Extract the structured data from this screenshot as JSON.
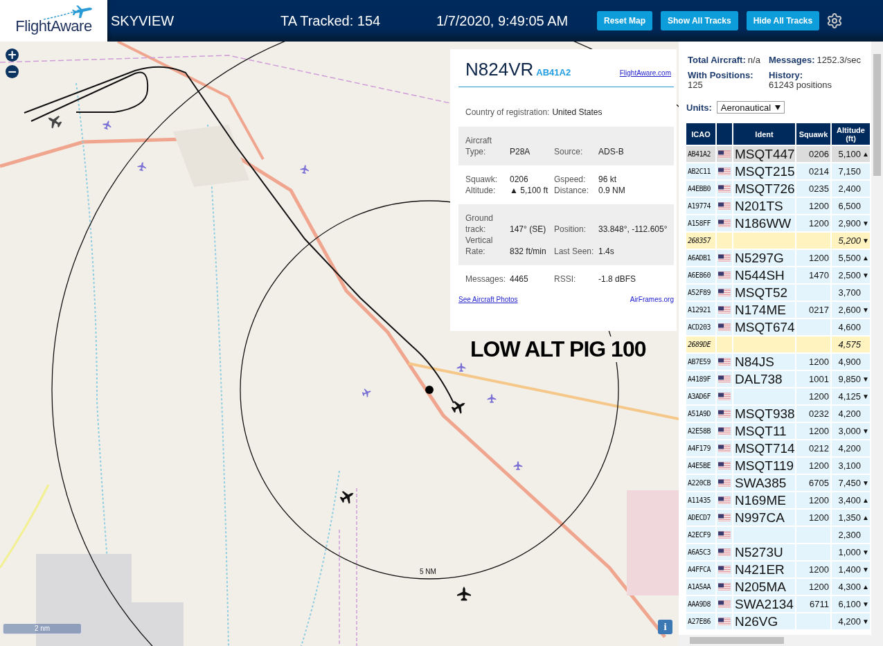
{
  "header": {
    "logo": "FlightAware",
    "title": "SKYVIEW",
    "tracked": "TA Tracked: 154",
    "datetime": "1/7/2020, 9:49:05 AM",
    "buttons": [
      "Reset Map",
      "Show All Tracks",
      "Hide All Tracks"
    ]
  },
  "map": {
    "zoom_in": "+",
    "zoom_out": "−",
    "range_label": "5 NM",
    "annotation": "LOW ALT PIG 100",
    "scale": "2 nm",
    "info_button": "i"
  },
  "popup": {
    "registration": "N824VR",
    "icao": "AB41A2",
    "link": "FlightAware.com",
    "country_label": "Country of registration:",
    "country": "United States",
    "sections": [
      {
        "shaded": true,
        "fields": [
          {
            "label": "Aircraft Type:",
            "value": "P28A"
          },
          {
            "label": "Source:",
            "value": "ADS-B"
          }
        ]
      },
      {
        "shaded": false,
        "fields": [
          {
            "label": "Squawk:",
            "value": "0206"
          },
          {
            "label": "Gspeed:",
            "value": "96 kt"
          },
          {
            "label": "Altitude:",
            "value": "▲ 5,100 ft"
          },
          {
            "label": "Distance:",
            "value": "0.9 NM"
          }
        ]
      },
      {
        "shaded": true,
        "fields": [
          {
            "label": "Ground track:",
            "value": "147° (SE)"
          },
          {
            "label": "Position:",
            "value": "33.848°, -112.605°"
          },
          {
            "label": "Vertical Rate:",
            "value": "832 ft/min"
          },
          {
            "label": "Last Seen:",
            "value": "1.4s"
          }
        ]
      },
      {
        "shaded": false,
        "fields": [
          {
            "label": "Messages:",
            "value": "4465"
          },
          {
            "label": "RSSI:",
            "value": "-1.8 dBFS"
          }
        ]
      }
    ],
    "photos_link": "See Aircraft Photos",
    "airframes_link": "AirFrames.org"
  },
  "stats": [
    {
      "label": "Total Aircraft:",
      "value": "n/a"
    },
    {
      "label": "Messages:",
      "value": "1252.3/sec"
    },
    {
      "label": "With Positions:",
      "value": "125"
    },
    {
      "label": "History:",
      "value": "61243 positions"
    }
  ],
  "units": {
    "label": "Units:",
    "value": "Aeronautical"
  },
  "table": {
    "columns": [
      "ICAO",
      "",
      "Ident",
      "Squawk",
      "Altitude (ft)"
    ],
    "rows": [
      {
        "kind": "normal",
        "selected": true,
        "icao": "AB41A2",
        "flag": true,
        "ident": "MSQT447",
        "squawk": "0206",
        "altitude": "5,100",
        "trend": "▲"
      },
      {
        "kind": "normal",
        "selected": false,
        "icao": "AB2C11",
        "flag": true,
        "ident": "MSQT215",
        "squawk": "0214",
        "altitude": "7,150"
      },
      {
        "kind": "normal",
        "selected": false,
        "icao": "A4EBB0",
        "flag": true,
        "ident": "MSQT726",
        "squawk": "0235",
        "altitude": "2,400"
      },
      {
        "kind": "normal",
        "selected": false,
        "icao": "A19774",
        "flag": true,
        "ident": "N201TS",
        "squawk": "1200",
        "altitude": "6,500"
      },
      {
        "kind": "normal",
        "selected": false,
        "icao": "A158FF",
        "flag": true,
        "ident": "N186WW",
        "squawk": "1200",
        "altitude": "2,900",
        "trend": "▼"
      },
      {
        "kind": "no_position",
        "selected": false,
        "icao": "268357",
        "flag": false,
        "altitude": "5,200",
        "trend": "▼"
      },
      {
        "kind": "normal",
        "selected": false,
        "icao": "A6ADB1",
        "flag": true,
        "ident": "N5297G",
        "squawk": "1200",
        "altitude": "5,500",
        "trend": "▲"
      },
      {
        "kind": "normal",
        "selected": false,
        "icao": "A6E860",
        "flag": true,
        "ident": "N544SH",
        "squawk": "1470",
        "altitude": "2,500",
        "trend": "▼"
      },
      {
        "kind": "normal",
        "selected": false,
        "icao": "A52F89",
        "flag": true,
        "ident": "MSQT52",
        "altitude": "3,700"
      },
      {
        "kind": "normal",
        "selected": false,
        "icao": "A12921",
        "flag": true,
        "ident": "N174ME",
        "squawk": "0217",
        "altitude": "2,600",
        "trend": "▼"
      },
      {
        "kind": "normal",
        "selected": false,
        "icao": "ACD203",
        "flag": true,
        "ident": "MSQT674",
        "altitude": "4,600"
      },
      {
        "kind": "no_position",
        "selected": false,
        "icao": "2689DE",
        "flag": false,
        "altitude": "4,575"
      },
      {
        "kind": "normal",
        "selected": false,
        "icao": "AB7E59",
        "flag": true,
        "ident": "N84JS",
        "squawk": "1200",
        "altitude": "4,900"
      },
      {
        "kind": "normal",
        "selected": false,
        "icao": "A4189F",
        "flag": true,
        "ident": "DAL738",
        "squawk": "1001",
        "altitude": "9,850",
        "trend": "▼"
      },
      {
        "kind": "normal",
        "selected": false,
        "icao": "A3AD6F",
        "flag": true,
        "squawk": "1200",
        "altitude": "4,125",
        "trend": "▼"
      },
      {
        "kind": "normal",
        "selected": false,
        "icao": "A51A9D",
        "flag": true,
        "ident": "MSQT938",
        "squawk": "0232",
        "altitude": "4,200"
      },
      {
        "kind": "normal",
        "selected": false,
        "icao": "A2E58B",
        "flag": true,
        "ident": "MSQT11",
        "squawk": "1200",
        "altitude": "3,000",
        "trend": "▼"
      },
      {
        "kind": "normal",
        "selected": false,
        "icao": "A4F179",
        "flag": true,
        "ident": "MSQT714",
        "squawk": "0212",
        "altitude": "4,200"
      },
      {
        "kind": "normal",
        "selected": false,
        "icao": "A4E5BE",
        "flag": true,
        "ident": "MSQT119",
        "squawk": "1200",
        "altitude": "3,100"
      },
      {
        "kind": "normal",
        "selected": false,
        "icao": "A220CB",
        "flag": true,
        "ident": "SWA385",
        "squawk": "6705",
        "altitude": "7,450",
        "trend": "▼"
      },
      {
        "kind": "normal",
        "selected": false,
        "icao": "A11435",
        "flag": true,
        "ident": "N169ME",
        "squawk": "1200",
        "altitude": "3,400",
        "trend": "▲"
      },
      {
        "kind": "normal",
        "selected": false,
        "icao": "ADECD7",
        "flag": true,
        "ident": "N997CA",
        "squawk": "1200",
        "altitude": "1,350",
        "trend": "▲"
      },
      {
        "kind": "normal",
        "selected": false,
        "icao": "A2ECF9",
        "flag": true,
        "altitude": "2,300"
      },
      {
        "kind": "normal",
        "selected": false,
        "icao": "A6A5C3",
        "flag": true,
        "ident": "N5273U",
        "altitude": "1,000",
        "trend": "▼"
      },
      {
        "kind": "normal",
        "selected": false,
        "icao": "A4FFCA",
        "flag": true,
        "ident": "N421ER",
        "squawk": "1200",
        "altitude": "1,400",
        "trend": "▼"
      },
      {
        "kind": "normal",
        "selected": false,
        "icao": "A1A5AA",
        "flag": true,
        "ident": "N205MA",
        "squawk": "1200",
        "altitude": "4,300",
        "trend": "▲"
      },
      {
        "kind": "normal",
        "selected": false,
        "icao": "AAA9D8",
        "flag": true,
        "ident": "SWA2134",
        "squawk": "6711",
        "altitude": "6,100",
        "trend": "▼"
      },
      {
        "kind": "normal",
        "selected": false,
        "icao": "A27E86",
        "flag": true,
        "ident": "N26VG",
        "altitude": "4,200",
        "trend": "▼"
      }
    ]
  }
}
